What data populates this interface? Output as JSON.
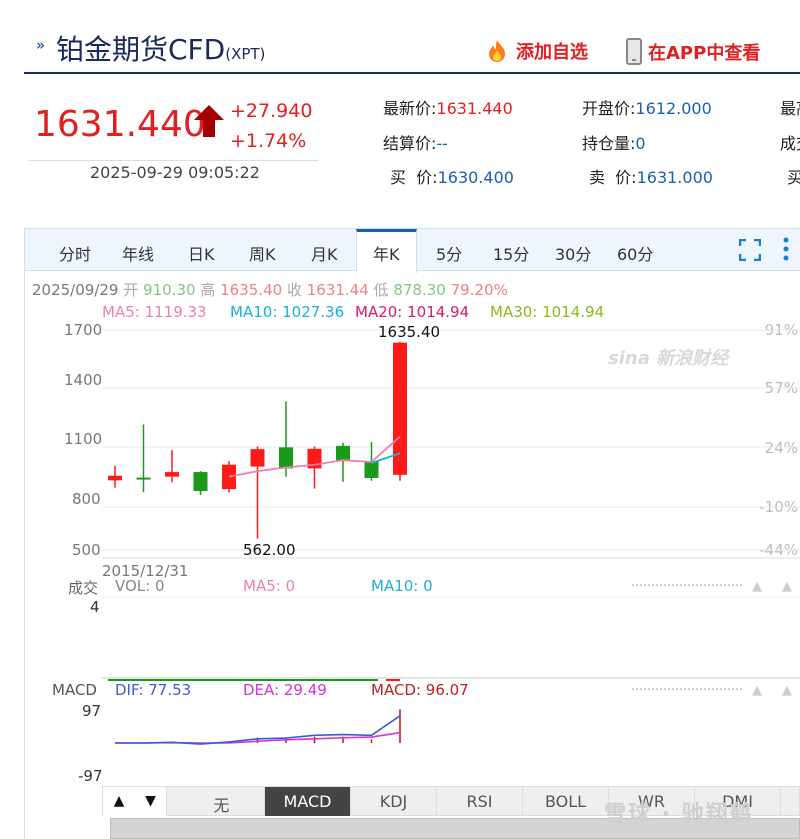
{
  "header": {
    "title": "铂金期货CFD",
    "subtitle": "(XPT)",
    "add_watch": "添加自选",
    "view_app": "在APP中查看"
  },
  "quote": {
    "price": "1631.440",
    "change": "+27.940",
    "change_pct": "+1.74%",
    "timestamp": "2025-09-29 09:05:22",
    "fields": [
      {
        "label": "最新价:",
        "value": "1631.440",
        "color": "red"
      },
      {
        "label": "开盘价:",
        "value": "1612.000",
        "color": "blue"
      },
      {
        "label": "最高",
        "value": "",
        "color": "blue"
      },
      {
        "label": "结算价:",
        "value": "--",
        "color": "blue"
      },
      {
        "label": "持仓量:",
        "value": "0",
        "color": "blue"
      },
      {
        "label": "成交",
        "value": "",
        "color": "blue"
      },
      {
        "label": "买  价:",
        "value": "1630.400",
        "color": "blue"
      },
      {
        "label": "卖  价:",
        "value": "1631.000",
        "color": "blue"
      },
      {
        "label": "买",
        "value": "",
        "color": "blue"
      }
    ]
  },
  "period_tabs": [
    "分时",
    "年线",
    "日K",
    "周K",
    "月K",
    "年K",
    "5分",
    "15分",
    "30分",
    "60分"
  ],
  "active_period": "年K",
  "ohlc": {
    "date": "2025/09/29",
    "open_label": "开",
    "open": "910.30",
    "high_label": "高",
    "high": "1635.40",
    "close_label": "收",
    "close": "1631.44",
    "low_label": "低",
    "low": "878.30",
    "pct": "79.20%"
  },
  "ma": {
    "ma5": "MA5: 1119.33",
    "ma10": "MA10: 1027.36",
    "ma20": "MA20: 1014.94",
    "ma30": "MA30: 1014.94"
  },
  "price_axis": [
    "1700",
    "1400",
    "1100",
    "800",
    "500"
  ],
  "pct_axis": [
    "91%",
    "57%",
    "24%",
    "-10%",
    "-44%"
  ],
  "start_date": "2015/12/31",
  "high_marker": "1635.40",
  "low_marker": "562.00",
  "watermark": "sina 新浪财经",
  "volume": {
    "label": "成交",
    "vol": "VOL: 0",
    "ma5": "MA5: 0",
    "ma10": "MA10: 0",
    "axis_value": "4"
  },
  "macd": {
    "label": "MACD",
    "dif": "DIF: 77.53",
    "dea": "DEA: 29.49",
    "macd": "MACD: 96.07",
    "axis_top": "97",
    "axis_bottom": "-97"
  },
  "indicator_tabs": [
    "无",
    "MACD",
    "KDJ",
    "RSI",
    "BOLL",
    "WR",
    "DMI"
  ],
  "active_indicator": "MACD",
  "nav": {
    "up": "▲",
    "down": "▼"
  },
  "corner_watermark": "雪球 · 驰翔鹤",
  "colors": {
    "up": "#ff1a1a",
    "down": "#1a9a1a",
    "ma5": "#f07fa8",
    "ma10": "#1ab0d8",
    "ma20": "#d81a6a",
    "ma30": "#8cb81a",
    "dif": "#3a5adf",
    "dea": "#d830d8"
  },
  "chart_data": {
    "type": "candlestick",
    "title": "",
    "ylim": [
      500,
      1700
    ],
    "candles": [
      {
        "open": 880,
        "close": 905,
        "high": 960,
        "low": 840
      },
      {
        "open": 895,
        "close": 890,
        "high": 1185,
        "low": 815
      },
      {
        "open": 900,
        "close": 925,
        "high": 1045,
        "low": 870
      },
      {
        "open": 925,
        "close": 822,
        "high": 930,
        "low": 800
      },
      {
        "open": 832,
        "close": 965,
        "high": 985,
        "low": 815
      },
      {
        "open": 955,
        "close": 1050,
        "high": 1065,
        "low": 562
      },
      {
        "open": 1060,
        "close": 945,
        "high": 1310,
        "low": 900
      },
      {
        "open": 945,
        "close": 1052,
        "high": 1065,
        "low": 835
      },
      {
        "open": 1068,
        "close": 985,
        "high": 1085,
        "low": 872
      },
      {
        "open": 985,
        "close": 893,
        "high": 1090,
        "low": 878
      },
      {
        "open": 910,
        "close": 1631,
        "high": 1635,
        "low": 878
      }
    ],
    "ma5": [
      null,
      null,
      null,
      null,
      900,
      930,
      950,
      965,
      990,
      980,
      1119
    ],
    "ma10": [
      null,
      null,
      null,
      null,
      null,
      null,
      null,
      null,
      null,
      975,
      1027
    ],
    "macd_dif": [
      0,
      0,
      2,
      -3,
      3,
      12,
      14,
      22,
      24,
      22,
      77.53
    ],
    "macd_dea": [
      0,
      0,
      1,
      0,
      0,
      5,
      9,
      12,
      15,
      17,
      29.49
    ],
    "macd_hist": [
      0,
      0,
      0,
      0,
      0,
      15,
      12,
      18,
      18,
      10,
      96.07
    ]
  }
}
